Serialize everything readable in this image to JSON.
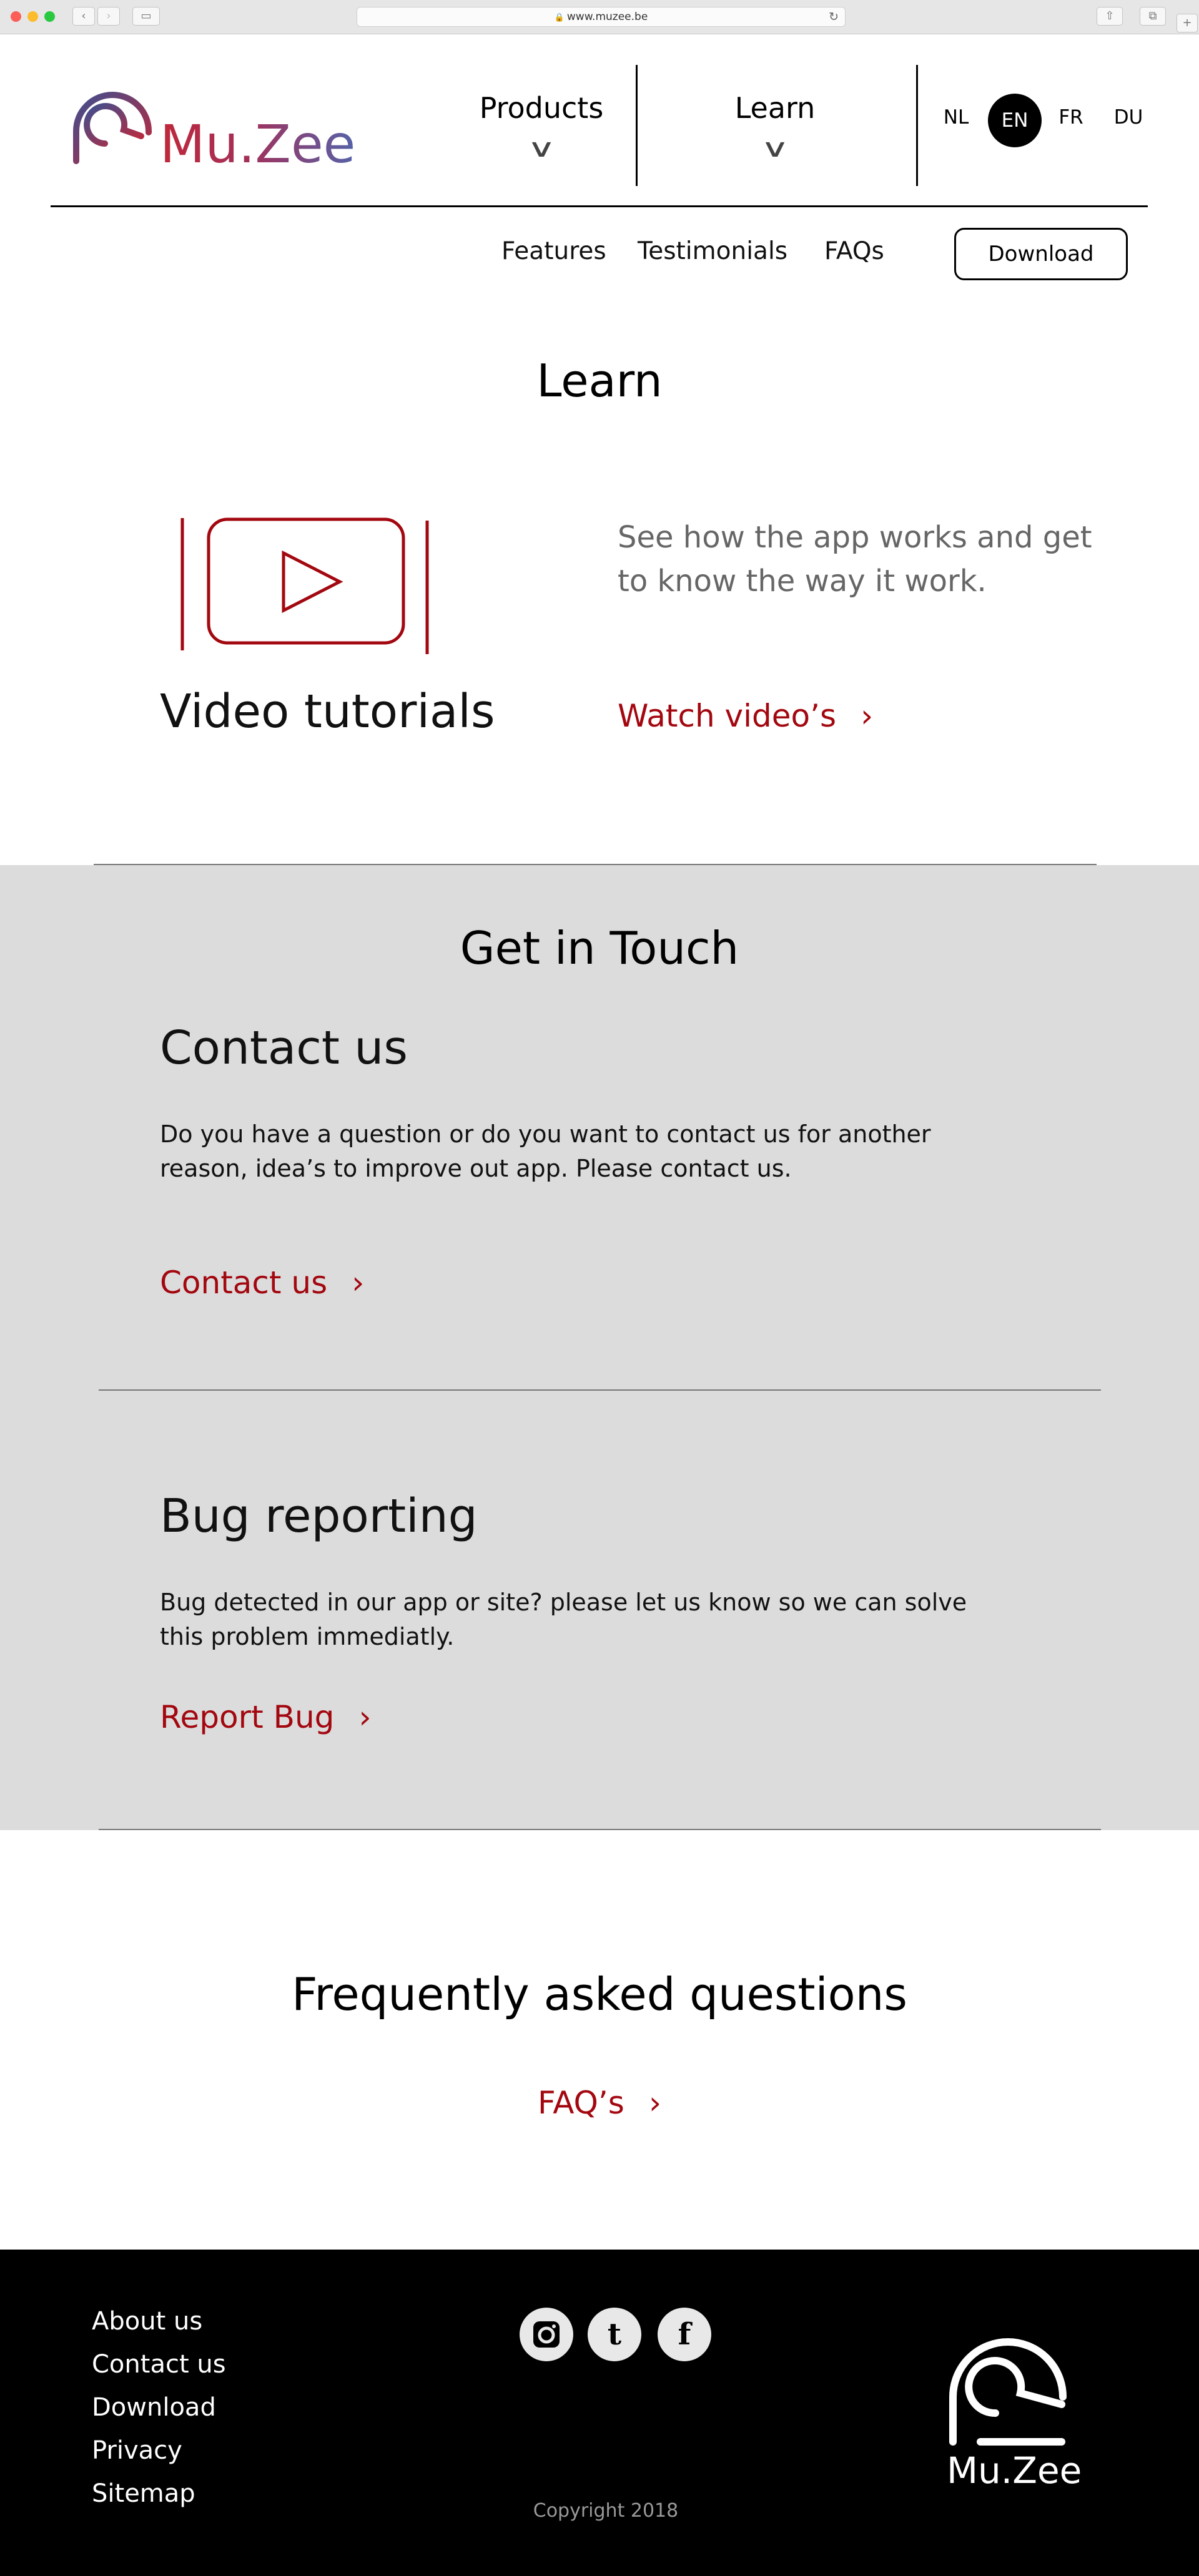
{
  "browser": {
    "url": "www.muzee.be",
    "lock_icon": "🔒",
    "back": "‹",
    "forward": "›",
    "sidebar_icon": "▭",
    "reload": "↻",
    "share": "⇧",
    "tabs": "⧉",
    "new_tab": "+"
  },
  "header": {
    "logo_text": "Mu.Zee",
    "nav": [
      {
        "label": "Products",
        "chevron": "⌄"
      },
      {
        "label": "Learn",
        "chevron": "⌄"
      }
    ],
    "languages": [
      "NL",
      "EN",
      "FR",
      "DU"
    ],
    "active_language": "EN",
    "subnav": [
      "Features",
      "Testimonials",
      "FAQs"
    ],
    "download_label": "Download"
  },
  "learn": {
    "title": "Learn",
    "card_title": "Video tutorials",
    "description": "See how the app works and get to know the way it work.",
    "link_label": "Watch video’s",
    "link_arrow": "›"
  },
  "touch": {
    "title": "Get in Touch",
    "contact": {
      "heading": "Contact us",
      "text": "Do you have a question or do you want to contact us for another reason, idea’s to improve out app. Please contact us.",
      "link_label": "Contact us",
      "link_arrow": "›"
    },
    "bug": {
      "heading": "Bug reporting",
      "text": "Bug detected in our app or site? please let us know so we can solve this problem immediatly.",
      "link_label": "Report Bug",
      "link_arrow": "›"
    }
  },
  "faq": {
    "title": "Frequently asked questions",
    "link_label": "FAQ’s",
    "link_arrow": "›"
  },
  "footer": {
    "links": [
      "About us",
      "Contact us",
      "Download",
      "Privacy",
      "Sitemap"
    ],
    "social": [
      {
        "name": "instagram"
      },
      {
        "name": "twitter",
        "glyph": "t"
      },
      {
        "name": "facebook",
        "glyph": "f"
      }
    ],
    "copyright": "Copyright 2018",
    "logo_text": "Mu.Zee"
  },
  "colors": {
    "accent_red": "#a3070f",
    "logo_purple": "#6a4a8e",
    "grey_section": "#dcdcdc"
  }
}
